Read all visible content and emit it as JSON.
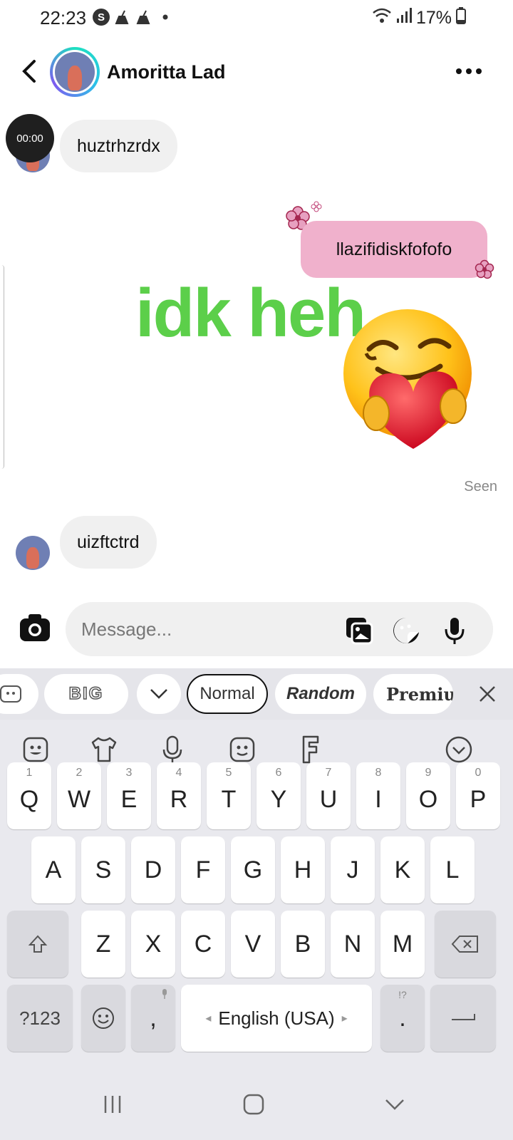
{
  "status_bar": {
    "time": "22:23",
    "battery": "17%",
    "icons": [
      "skype-icon",
      "broom-icon",
      "broom-icon",
      "dot-icon",
      "wifi-icon",
      "signal-icon",
      "battery-icon"
    ]
  },
  "header": {
    "contact_name": "Amoritta Lad",
    "back_icon": "back-arrow-icon",
    "more_icon": "more-dots-icon"
  },
  "messages": [
    {
      "from": "them",
      "text": "huztrhzrdx",
      "timer": "00:00"
    },
    {
      "from": "me",
      "text": "llazifidiskfofofo"
    },
    {
      "from": "me",
      "type": "sticker",
      "text": "idk heh",
      "emoji": "smiling-face-with-heart-emoji"
    },
    {
      "from": "me",
      "status": "Seen"
    },
    {
      "from": "them",
      "text": "uizftctrd"
    }
  ],
  "composer": {
    "placeholder": "Message...",
    "icons": [
      "camera-icon",
      "gallery-icon",
      "sticker-icon",
      "microphone-icon"
    ]
  },
  "keyboard": {
    "font_chips": [
      "BIG",
      "Normal",
      "Random",
      "Premium"
    ],
    "toolbar_icons": [
      "emoji-icon",
      "shirt-icon",
      "mic-icon",
      "sticker-face-icon",
      "font-icon",
      "collapse-icon"
    ],
    "row1": [
      {
        "key": "Q",
        "num": "1"
      },
      {
        "key": "W",
        "num": "2"
      },
      {
        "key": "E",
        "num": "3"
      },
      {
        "key": "R",
        "num": "4"
      },
      {
        "key": "T",
        "num": "5"
      },
      {
        "key": "Y",
        "num": "6"
      },
      {
        "key": "U",
        "num": "7"
      },
      {
        "key": "I",
        "num": "8"
      },
      {
        "key": "O",
        "num": "9"
      },
      {
        "key": "P",
        "num": "0"
      }
    ],
    "row2": [
      "A",
      "S",
      "D",
      "F",
      "G",
      "H",
      "J",
      "K",
      "L"
    ],
    "row3": [
      "Z",
      "X",
      "C",
      "V",
      "B",
      "N",
      "M"
    ],
    "symbols_key": "?123",
    "comma_key": ",",
    "space_key": "English (USA)",
    "period_key": ".",
    "period_alt": "!?"
  },
  "colors": {
    "outgoing_bubble": "#f0b1cc",
    "incoming_bubble": "#f0f0f0",
    "sticker_text": "#5ccf4a",
    "keyboard_bg": "#e9e9ee"
  }
}
